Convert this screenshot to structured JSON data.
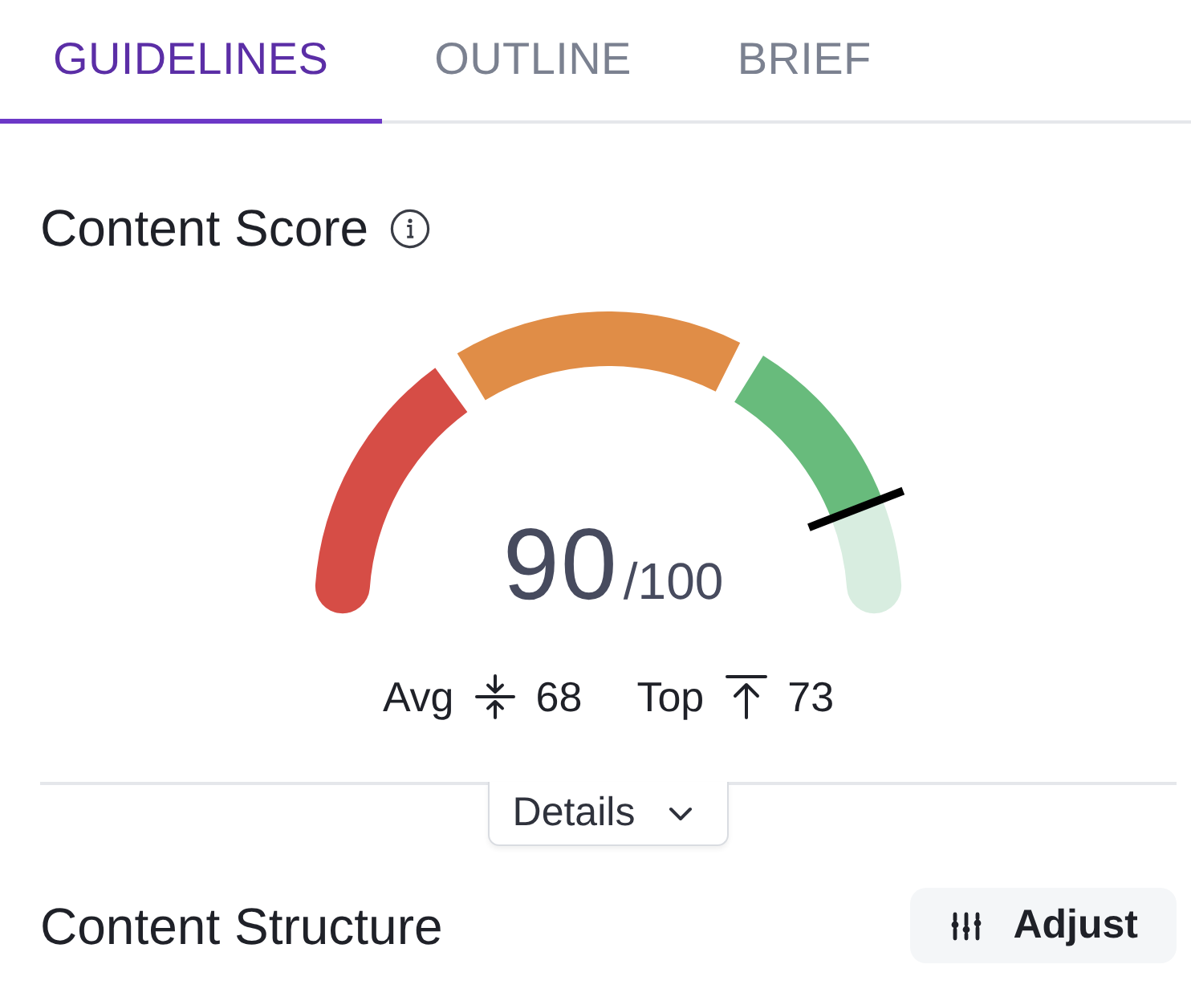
{
  "tabs": [
    {
      "label": "GUIDELINES",
      "selected": true
    },
    {
      "label": "OUTLINE",
      "selected": false
    },
    {
      "label": "BRIEF",
      "selected": false
    }
  ],
  "content_score": {
    "title": "Content Score",
    "score": "90",
    "score_max": "/100",
    "level": 0.9,
    "benchmarks": [
      {
        "kind": "avg",
        "label": "Avg",
        "value": "68"
      },
      {
        "kind": "top",
        "label": "Top",
        "value": "73"
      }
    ],
    "details_button": "Details"
  },
  "content_structure": {
    "title": "Content Structure",
    "adjust_button": "Adjust"
  }
}
